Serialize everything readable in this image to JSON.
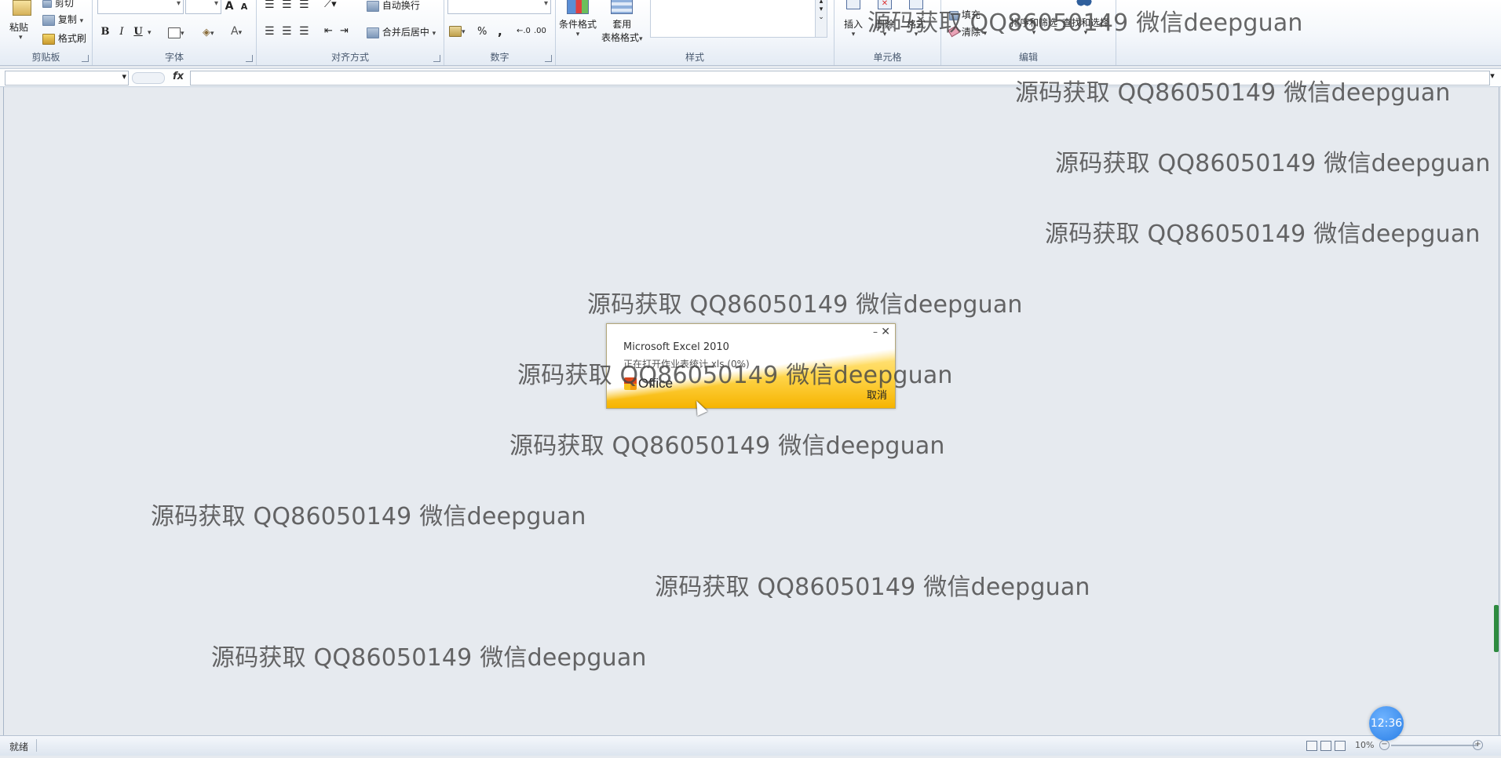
{
  "ribbon": {
    "clipboard": {
      "label": "剪贴板",
      "paste": "粘贴",
      "cut": "剪切",
      "copy": "复制",
      "format_painter": "格式刷"
    },
    "font": {
      "label": "字体",
      "bold": "B",
      "italic": "I",
      "underline": "U",
      "grow": "A",
      "shrink": "A"
    },
    "alignment": {
      "label": "对齐方式",
      "wrap_text": "自动换行",
      "merge_center": "合并后居中"
    },
    "number": {
      "label": "数字",
      "percent": "%",
      "comma": ","
    },
    "styles": {
      "label": "样式",
      "conditional_format": "条件格式",
      "table_format_line1": "套用",
      "table_format_line2": "表格格式"
    },
    "cells": {
      "label": "单元格",
      "insert": "插入",
      "delete": "删除",
      "format": "格式"
    },
    "editing": {
      "label": "编辑",
      "fill": "填充",
      "clear": "清除",
      "sort_filter": "排序和筛选",
      "find_select": "查找和选择"
    }
  },
  "formula_bar": {
    "fx": "fx",
    "name_box": "",
    "formula": ""
  },
  "watermarks": [
    "源码获取 QQ86050149 微信deepguan",
    "源码获取 QQ86050149 微信deepguan",
    "源码获取 QQ86050149 微信deepguan",
    "源码获取 QQ86050149 微信deepguan",
    "源码获取 QQ86050149 微信deepguan",
    "源码获取 QQ86050149 微信deepguan",
    "源码获取 QQ86050149 微信deepguan",
    "源码获取 QQ86050149 微信deepguan",
    "源码获取 QQ86050149 微信deepguan",
    "源码获取 QQ86050149 微信deepguan"
  ],
  "splash": {
    "product": "Microsoft Excel 2010",
    "status": "正在打开作业表统计.xls (0%)",
    "logo_text": "Office",
    "cancel": "取消",
    "minimize": "–",
    "close": "✕"
  },
  "status_bar": {
    "ready": "就绪",
    "zoom": "10%",
    "zoom_minus": "−",
    "zoom_plus": "+"
  },
  "timer": "12:36"
}
